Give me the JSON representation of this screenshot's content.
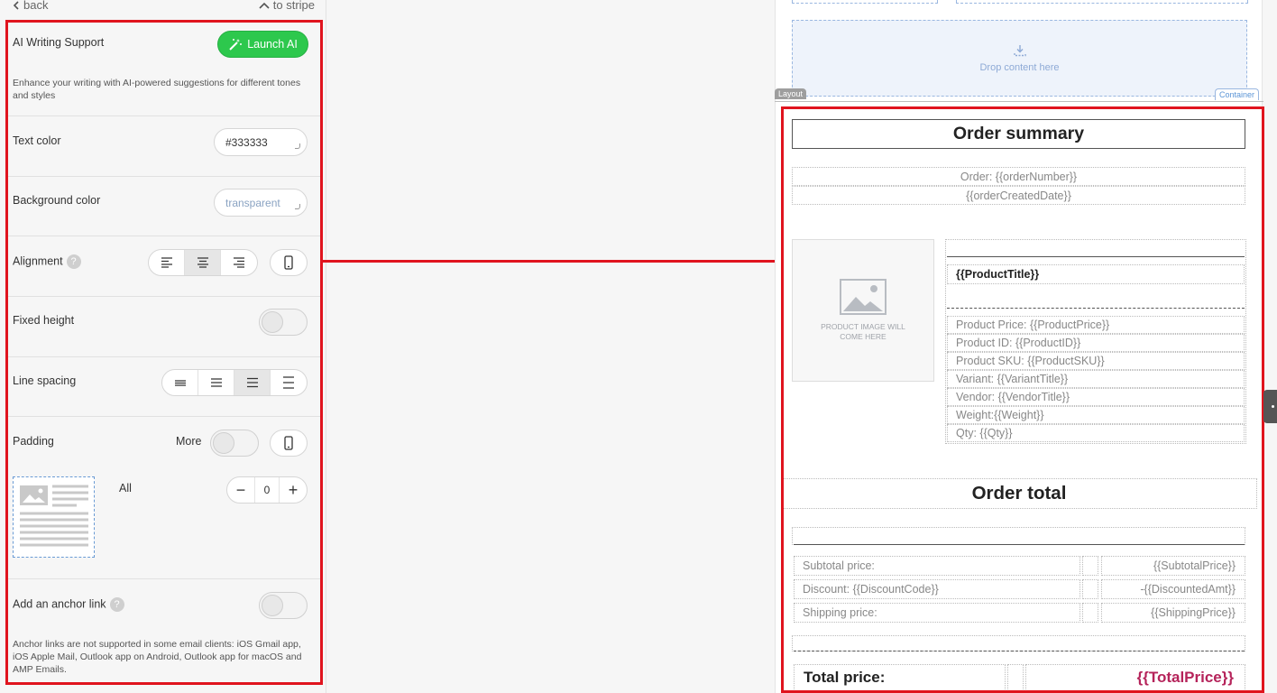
{
  "nav": {
    "back": "back",
    "to_stripe": "to stripe"
  },
  "ai": {
    "label": "AI Writing Support",
    "button": "Launch AI",
    "description": "Enhance your writing with AI-powered suggestions for different tones and styles"
  },
  "text_color": {
    "label": "Text color",
    "value": "#333333"
  },
  "background_color": {
    "label": "Background color",
    "value": "transparent"
  },
  "alignment": {
    "label": "Alignment",
    "help": "?",
    "selected": "center"
  },
  "fixed_height": {
    "label": "Fixed height",
    "enabled": false
  },
  "line_spacing": {
    "label": "Line spacing",
    "selected": 2
  },
  "padding": {
    "label": "Padding",
    "more": "More",
    "all_label": "All",
    "value": "0",
    "minus": "−",
    "plus": "+"
  },
  "anchor": {
    "label": "Add an anchor link",
    "help": "?",
    "enabled": false,
    "note": "Anchor links are not supported in some email clients: iOS Gmail app, iOS Apple Mail, Outlook app on Android, Outlook app for macOS and AMP Emails."
  },
  "canvas": {
    "drop_text": "Drop content here",
    "layout_tag": "Layout",
    "container_tag": "Container",
    "order_summary_title": "Order summary",
    "order_number": "Order: {{orderNumber}}",
    "order_date": "{{orderCreatedDate}}",
    "image_placeholder": "PRODUCT IMAGE WILL COME HERE",
    "product_title": "{{ProductTitle}}",
    "product_fields": [
      "Product Price: {{ProductPrice}}",
      "Product ID: {{ProductID}}",
      "Product SKU: {{ProductSKU}}",
      "Variant: {{VariantTitle}}",
      "Vendor: {{VendorTitle}}",
      "Weight:{{Weight}}",
      "Qty: {{Qty}}"
    ],
    "order_total_title": "Order total",
    "totals": [
      {
        "label": "Subtotal price:",
        "value": "{{SubtotalPrice}}"
      },
      {
        "label": "Discount: {{DiscountCode}}",
        "value": "-{{DiscountedAmt}}"
      },
      {
        "label": "Shipping price:",
        "value": "{{ShippingPrice}}"
      }
    ],
    "total_price_label": "Total price:",
    "total_price_value": "{{TotalPrice}}"
  },
  "colors": {
    "highlight": "#e0141e",
    "launch_green": "#2dc84d",
    "total_price": "#b5235a",
    "drop_zone": "#eef3fb"
  }
}
